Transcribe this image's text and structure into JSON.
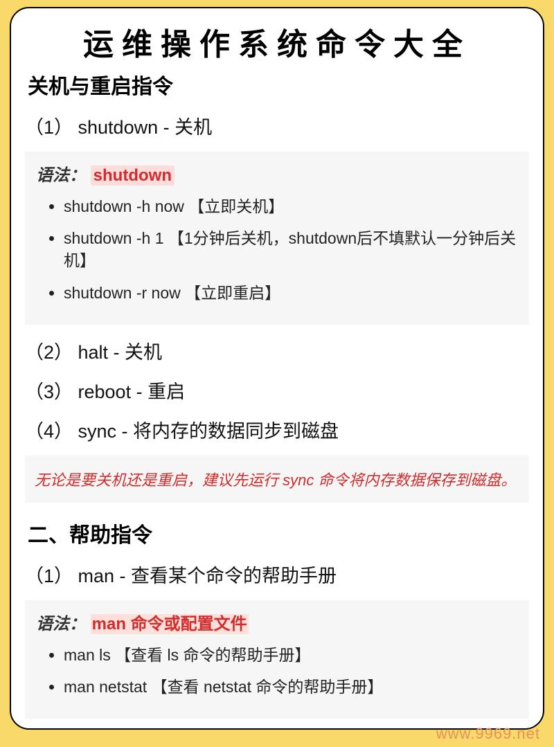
{
  "title": "运维操作系统命令大全",
  "section1": {
    "heading": "关机与重启指令",
    "items": [
      {
        "header": "（1） shutdown - 关机",
        "syntax_label": "语法：",
        "syntax_cmd": "shutdown",
        "bullets": [
          "shutdown -h now 【立即关机】",
          "shutdown -h 1 【1分钟后关机，shutdown后不填默认一分钟后关机】",
          "shutdown -r now 【立即重启】"
        ]
      },
      {
        "header": "（2） halt - 关机"
      },
      {
        "header": "（3） reboot - 重启"
      },
      {
        "header": "（4） sync - 将内存的数据同步到磁盘"
      }
    ],
    "note": "无论是要关机还是重启，建议先运行 sync 命令将内存数据保存到磁盘。"
  },
  "section2": {
    "heading": "二、帮助指令",
    "items": [
      {
        "header": "（1） man - 查看某个命令的帮助手册",
        "syntax_label": "语法：",
        "syntax_cmd": "man 命令或配置文件",
        "bullets": [
          "man ls 【查看 ls 命令的帮助手册】",
          "man netstat 【查看 netstat 命令的帮助手册】"
        ]
      }
    ]
  },
  "watermark": "www.9969.net"
}
